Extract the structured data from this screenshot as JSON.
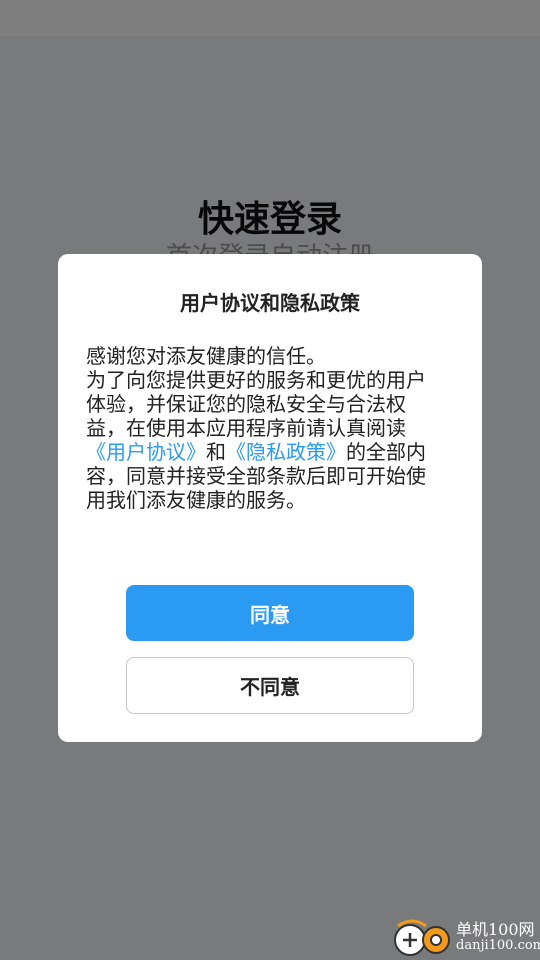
{
  "background": {
    "title": "快速登录",
    "subtitle": "首次登录自动注册"
  },
  "dialog": {
    "title": "用户协议和隐私政策",
    "body": {
      "line1": "感谢您对添友健康的信任。",
      "line2_prefix": "为了向您提供更好的服务和更优的用户体验，并保证您的隐私安全与合法权益，在使用本应用程序前请认真阅读",
      "user_agreement_link": "《用户协议》",
      "and": "和",
      "privacy_policy_link": "《隐私政策》",
      "line2_suffix": "的全部内容，同意并接受全部条款后即可开始使用我们添友健康的服务。"
    },
    "agree_label": "同意",
    "disagree_label": "不同意"
  },
  "watermark": {
    "name": "单机100网",
    "url": "danji100.com"
  },
  "colors": {
    "accent": "#2b9af3",
    "overlay": "rgba(0,0,0,0.5)"
  }
}
